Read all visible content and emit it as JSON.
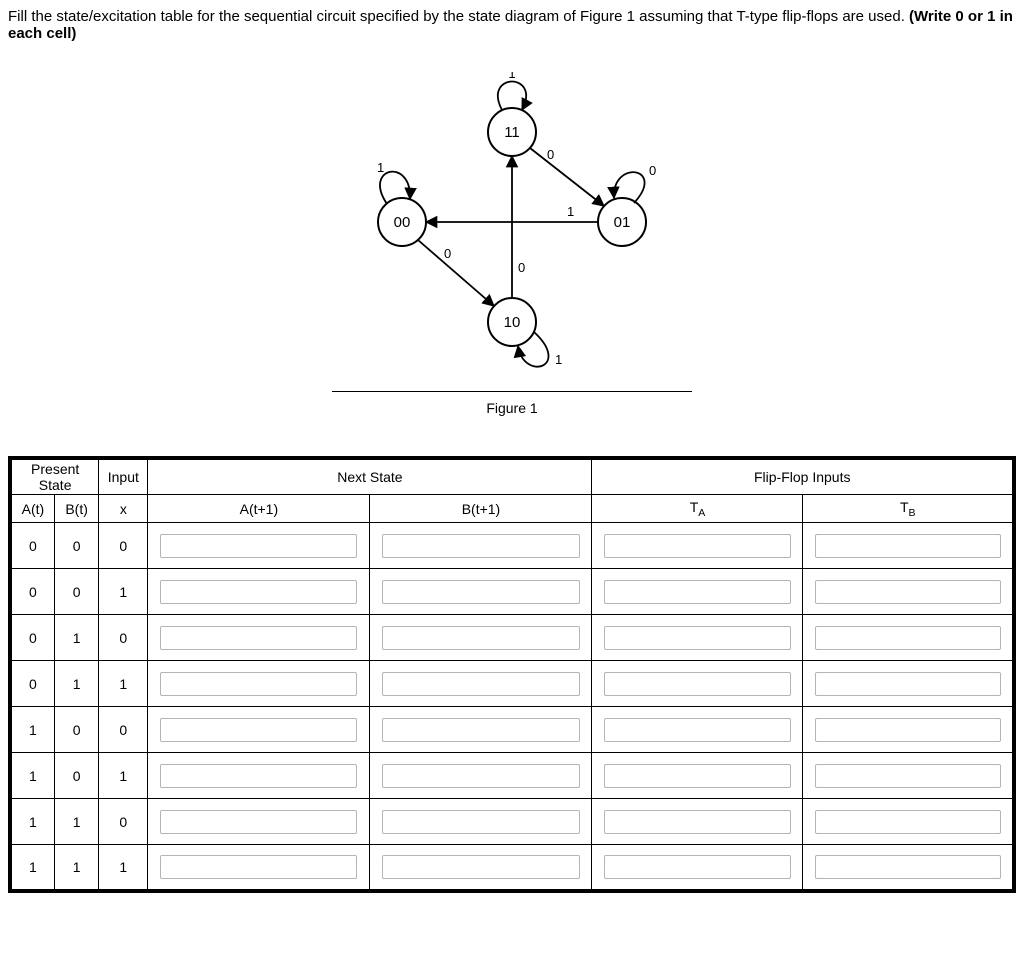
{
  "instruction": {
    "pre": "Fill the state/excitation table for the sequential circuit specified by the state diagram of Figure 1 assuming that T-type flip-flops are used.  ",
    "bold": "(Write 0 or 1 in each cell)"
  },
  "diagram": {
    "states": {
      "s00": "00",
      "s01": "01",
      "s10": "10",
      "s11": "11"
    },
    "edges": {
      "e00_self": "1",
      "e00_to10": "0",
      "e01_self": "0",
      "e01_to00": "1",
      "e10_self": "1",
      "e10_to11": "0",
      "e11_self": "1",
      "e11_to01": "0"
    },
    "caption": "Figure 1"
  },
  "table": {
    "group_headers": {
      "present": "Present State",
      "input": "Input",
      "next": "Next State",
      "ff": "Flip-Flop Inputs"
    },
    "sub_headers": {
      "At": "A(t)",
      "Bt": "B(t)",
      "x": "x",
      "At1": "A(t+1)",
      "Bt1": "B(t+1)",
      "TA_base": "T",
      "TA_sub": "A",
      "TB_base": "T",
      "TB_sub": "B"
    },
    "rows": [
      {
        "At": "0",
        "Bt": "0",
        "x": "0"
      },
      {
        "At": "0",
        "Bt": "0",
        "x": "1"
      },
      {
        "At": "0",
        "Bt": "1",
        "x": "0"
      },
      {
        "At": "0",
        "Bt": "1",
        "x": "1"
      },
      {
        "At": "1",
        "Bt": "0",
        "x": "0"
      },
      {
        "At": "1",
        "Bt": "0",
        "x": "1"
      },
      {
        "At": "1",
        "Bt": "1",
        "x": "0"
      },
      {
        "At": "1",
        "Bt": "1",
        "x": "1"
      }
    ]
  }
}
